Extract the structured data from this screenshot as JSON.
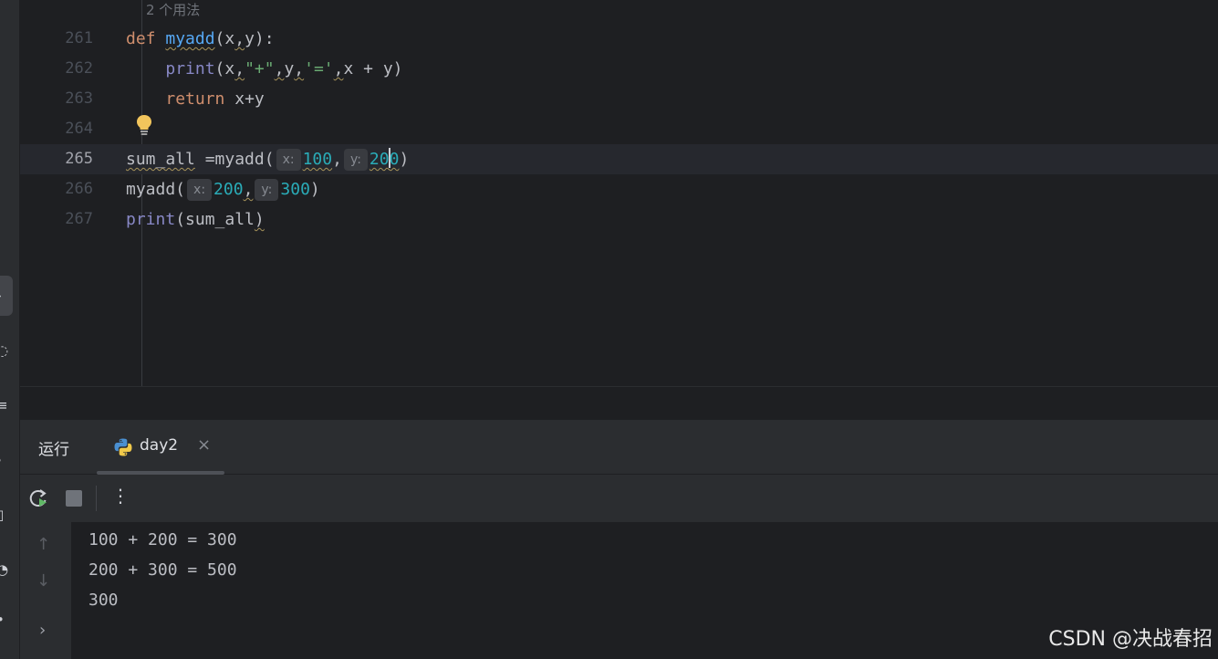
{
  "editor": {
    "usages_hint": "2 个用法",
    "lines": [
      {
        "num": "261",
        "tokens": [
          {
            "t": "def",
            "c": "kw"
          },
          {
            "t": " "
          },
          {
            "t": "myadd",
            "c": "fn warn"
          },
          {
            "t": "(x"
          },
          {
            "t": ",",
            "c": "warn"
          },
          {
            "t": "y):"
          }
        ]
      },
      {
        "num": "262",
        "tokens": [
          {
            "t": "    "
          },
          {
            "t": "print",
            "c": "builtin"
          },
          {
            "t": "(x"
          },
          {
            "t": ",",
            "c": "warn"
          },
          {
            "t": "\"+\"",
            "c": "str"
          },
          {
            "t": ",",
            "c": "warn"
          },
          {
            "t": "y"
          },
          {
            "t": ",",
            "c": "warn"
          },
          {
            "t": "'='",
            "c": "str"
          },
          {
            "t": ",",
            "c": "warn"
          },
          {
            "t": "x + y)"
          }
        ]
      },
      {
        "num": "263",
        "tokens": [
          {
            "t": "    "
          },
          {
            "t": "return",
            "c": "kw"
          },
          {
            "t": " x+y"
          }
        ]
      },
      {
        "num": "264",
        "tokens": []
      },
      {
        "num": "265",
        "current": true,
        "tokens": [
          {
            "t": "sum_all",
            "c": "warn"
          },
          {
            "t": " =myadd("
          },
          {
            "hint": "x:"
          },
          {
            "t": "100",
            "c": "num warn"
          },
          {
            "t": ","
          },
          {
            "hint": "y:"
          },
          {
            "t": "20",
            "c": "num warn"
          },
          {
            "caret": true
          },
          {
            "t": "0",
            "c": "num warn"
          },
          {
            "t": ")"
          }
        ]
      },
      {
        "num": "266",
        "tokens": [
          {
            "t": "myadd("
          },
          {
            "hint": "x:"
          },
          {
            "t": "200",
            "c": "num"
          },
          {
            "t": ",",
            "c": "warn"
          },
          {
            "hint": "y:"
          },
          {
            "t": "300",
            "c": "num"
          },
          {
            "t": ")"
          }
        ]
      },
      {
        "num": "267",
        "tokens": [
          {
            "t": "print",
            "c": "builtin"
          },
          {
            "t": "(sum_all"
          },
          {
            "t": ")",
            "c": "warn"
          }
        ]
      }
    ]
  },
  "run_panel": {
    "title": "运行",
    "tab_label": "day2",
    "tab_close": "×",
    "toolbar": {
      "rerun_icon": "rerun-icon",
      "stop_icon": "stop-icon",
      "more_icon": "more-vertical-icon",
      "more_glyph": "⋮"
    },
    "side": {
      "up": "↑",
      "down": "↓",
      "expand": "›"
    },
    "output": [
      "100 + 200 = 300",
      "200 + 300 = 500",
      "300"
    ]
  },
  "watermark": "CSDN @决战春招",
  "colors": {
    "keyword": "#cf8e6d",
    "function": "#56a8f5",
    "builtin": "#8888c6",
    "string": "#6aab73",
    "number": "#2aacb8",
    "background": "#1e1f22",
    "panel": "#2b2d30"
  }
}
